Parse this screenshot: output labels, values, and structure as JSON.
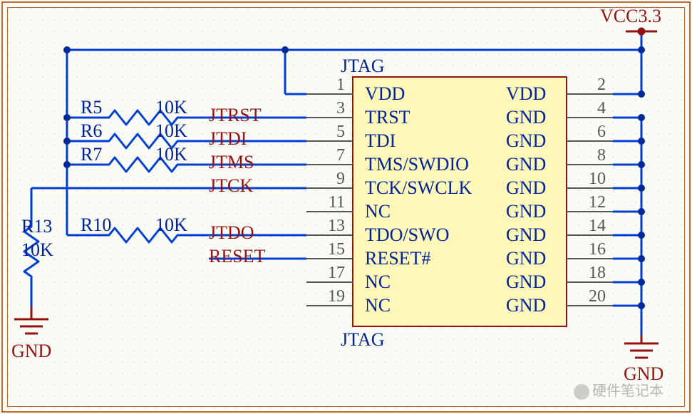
{
  "power": {
    "vcc": "VCC3.3",
    "gnd": "GND"
  },
  "component": {
    "designator_top": "JTAG",
    "designator_bottom": "JTAG"
  },
  "pins_left": [
    {
      "num": "1",
      "name": "VDD"
    },
    {
      "num": "3",
      "name": "TRST"
    },
    {
      "num": "5",
      "name": "TDI"
    },
    {
      "num": "7",
      "name": "TMS/SWDIO"
    },
    {
      "num": "9",
      "name": "TCK/SWCLK"
    },
    {
      "num": "11",
      "name": "NC"
    },
    {
      "num": "13",
      "name": "TDO/SWO"
    },
    {
      "num": "15",
      "name": "RESET#"
    },
    {
      "num": "17",
      "name": "NC"
    },
    {
      "num": "19",
      "name": "NC"
    }
  ],
  "pins_right": [
    {
      "num": "2",
      "name": "VDD"
    },
    {
      "num": "4",
      "name": "GND"
    },
    {
      "num": "6",
      "name": "GND"
    },
    {
      "num": "8",
      "name": "GND"
    },
    {
      "num": "10",
      "name": "GND"
    },
    {
      "num": "12",
      "name": "GND"
    },
    {
      "num": "14",
      "name": "GND"
    },
    {
      "num": "16",
      "name": "GND"
    },
    {
      "num": "18",
      "name": "GND"
    },
    {
      "num": "20",
      "name": "GND"
    }
  ],
  "nets_left": {
    "3": "JTRST",
    "5": "JTDI",
    "7": "JTMS",
    "9": "JTCK",
    "13": "JTDO",
    "15": "RESET"
  },
  "resistors": [
    {
      "ref": "R5",
      "val": "10K"
    },
    {
      "ref": "R6",
      "val": "10K"
    },
    {
      "ref": "R7",
      "val": "10K"
    },
    {
      "ref": "R10",
      "val": "10K"
    },
    {
      "ref": "R13",
      "val": "10K"
    }
  ],
  "watermark": "硬件笔记本"
}
